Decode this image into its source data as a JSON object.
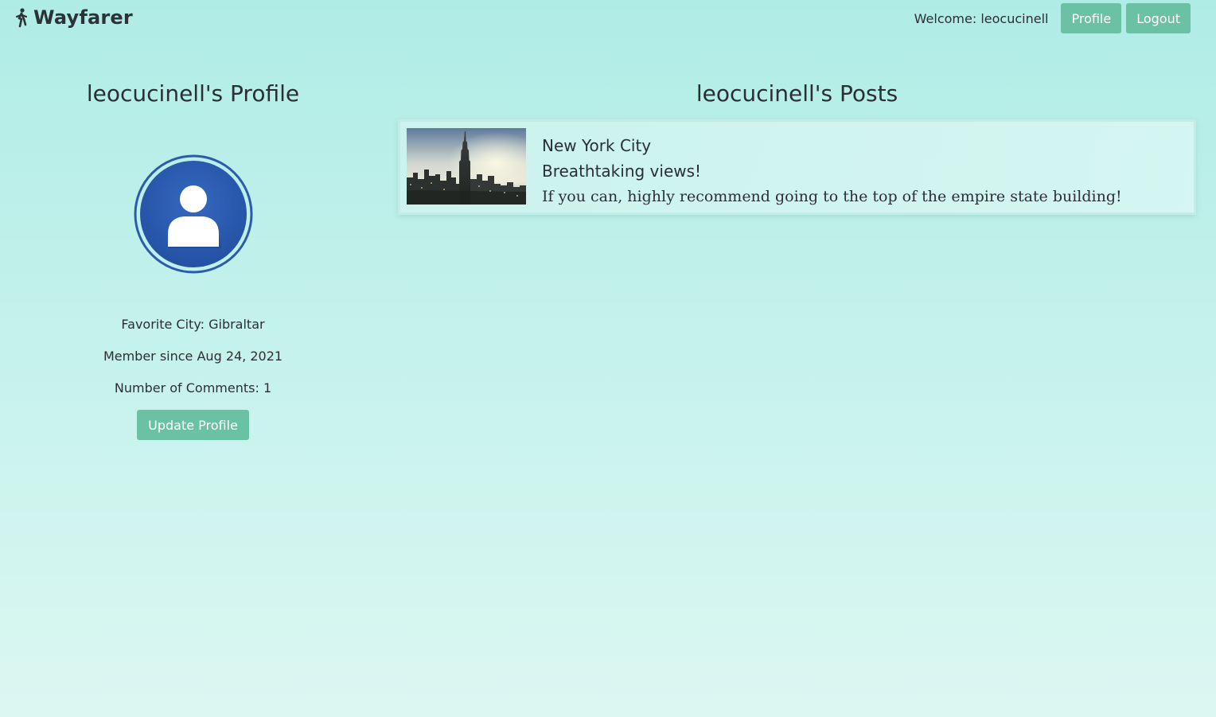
{
  "navbar": {
    "brand": "Wayfarer",
    "brand_icon": "walking-person-icon",
    "welcome": "Welcome: leocucinell",
    "profile_label": "Profile",
    "logout_label": "Logout"
  },
  "profile": {
    "title": "leocucinell's Profile",
    "avatar_icon": "user-avatar-icon",
    "favorite_city": "Favorite City: Gibraltar",
    "member_since": "Member since Aug 24, 2021",
    "comments": "Number of Comments: 1",
    "update_label": "Update Profile"
  },
  "posts": {
    "title": "leocucinell's Posts",
    "items": [
      {
        "city": "New York City",
        "title": "Breathtaking views!",
        "body": "If you can, highly recommend going to the top of the empire state building!",
        "image": "new-york-skyline-photo"
      }
    ]
  },
  "colors": {
    "accent": "#6ac1a3",
    "background_top": "#b0ece6",
    "background_bottom": "#dcf7f2",
    "avatar_blue": "#2c5aae",
    "text": "#2b2f33"
  }
}
